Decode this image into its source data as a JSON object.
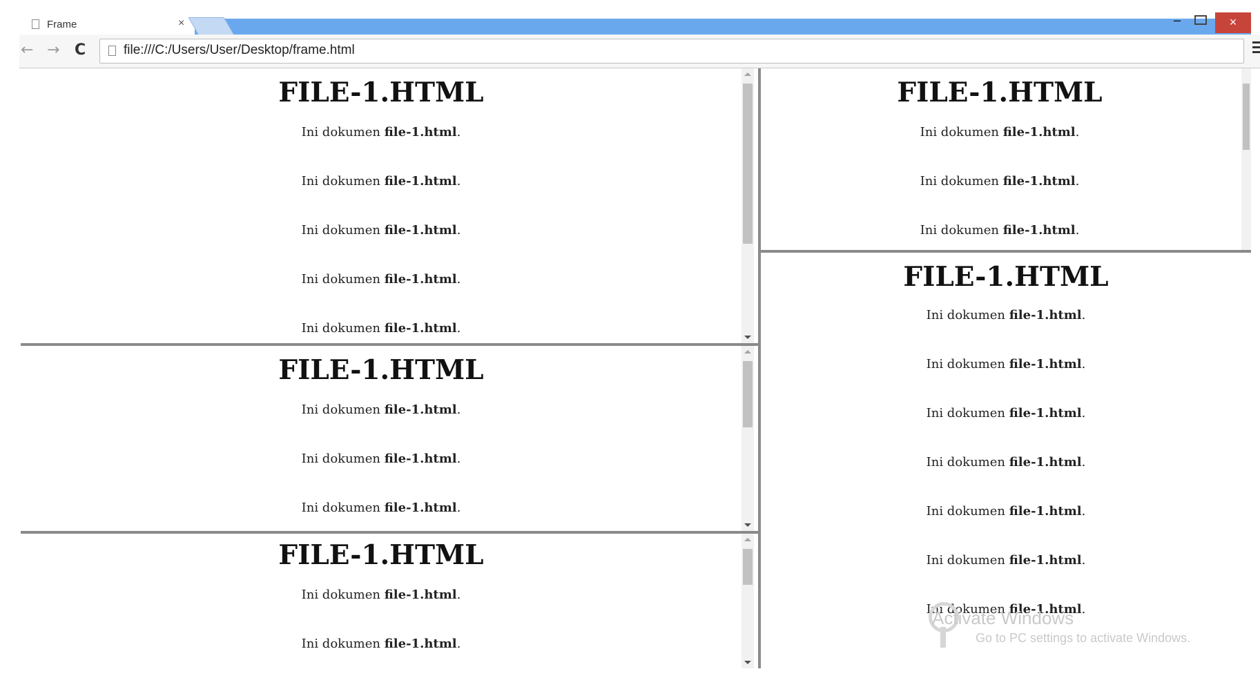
{
  "browser": {
    "tab_title": "Frame",
    "tab_close": "×",
    "address": "file:///C:/Users/User/Desktop/frame.html",
    "back": "←",
    "forward": "→",
    "reload": "C",
    "star": "☆",
    "win_min": "–",
    "win_close": "×"
  },
  "frames": [
    {
      "heading": "FILE-1.HTML",
      "prefix": "Ini dokumen ",
      "bold": "file-1.html",
      "suffix": ".",
      "visible_paragraphs": 5
    },
    {
      "heading": "FILE-1.HTML",
      "prefix": "Ini dokumen ",
      "bold": "file-1.html",
      "suffix": ".",
      "visible_paragraphs": 3
    },
    {
      "heading": "FILE-1.HTML",
      "prefix": "Ini dokumen ",
      "bold": "file-1.html",
      "suffix": ".",
      "visible_paragraphs": 2
    },
    {
      "heading": "FILE-1.HTML",
      "prefix": "Ini dokumen ",
      "bold": "file-1.html",
      "suffix": ".",
      "visible_paragraphs": 3
    },
    {
      "heading": "FILE-1.HTML",
      "prefix": "Ini dokumen ",
      "bold": "file-1.html",
      "suffix": ".",
      "visible_paragraphs": 7
    }
  ],
  "watermark": {
    "title": "Activate Windows",
    "subtitle": "Go to PC settings to activate Windows."
  }
}
